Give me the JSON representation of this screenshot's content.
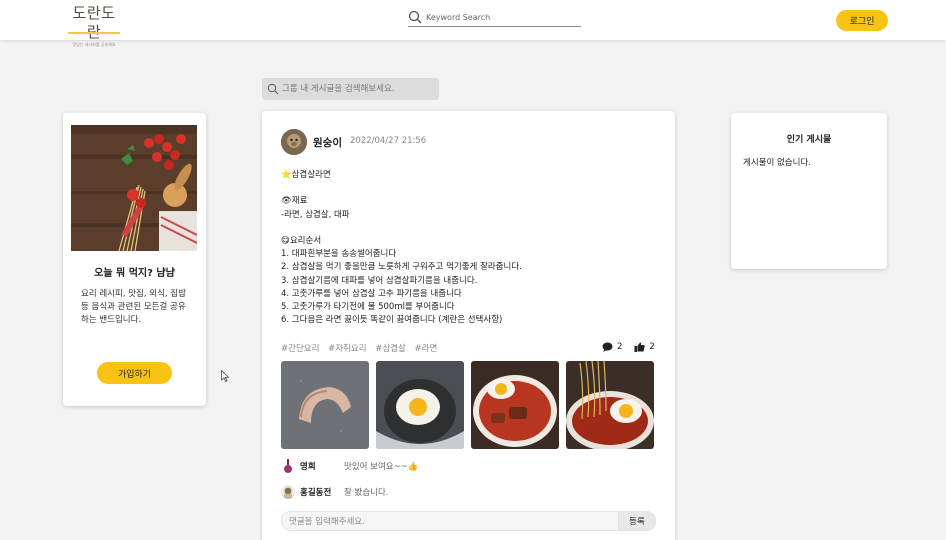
{
  "header": {
    "logo_title": "도란도란",
    "logo_sub": "맛있는 레시피를 공유해요",
    "search_placeholder": "Keyword Search",
    "login_label": "로그인"
  },
  "group_search": {
    "placeholder": "그룹 내 게시글을 검색해보세요."
  },
  "band": {
    "title": "오늘 뭐 먹지? 냠냠",
    "description": "요리 레시피, 맛집, 외식, 집밥 등 음식과 관련된 모든걸 공유하는 밴드입니다.",
    "join_label": "가입하기"
  },
  "post": {
    "author": "원숭이",
    "date": "2022/04/27 21:56",
    "lines": [
      "⭐삼겹살라면",
      "",
      "👁재료",
      "-라면, 삼겹살, 대파",
      "",
      "😋요리순서",
      "1. 대파흰부분을 송송썰어줍니다",
      "2. 삼겹살을 먹기 좋을만큼 노릇하게 구워주고 먹기좋게 잘라줍니다.",
      "3. 삼겹살기름에 대파를 넣어 삼겹살파기름을 내줍니다.",
      "4. 고춧가루를 넣어 삼겹살 고추 파기름을 내줍니다",
      "5. 고춧가루가 타기전에 물 500ml를 부어줍니다",
      "6. 그다음은 라면 끓이듯 똑같이 끓여줍니다 (계란은 선택사항)"
    ],
    "tags": [
      "#간단요리",
      "#자취요리",
      "#삼겹살",
      "#라면"
    ],
    "comment_count": "2",
    "like_count": "2",
    "comments": [
      {
        "name": "영희",
        "text": "맛있어 보여요~~👍"
      },
      {
        "name": "홍길동전",
        "text": "잘 봤습니다."
      }
    ],
    "comment_placeholder": "댓글을 입력해주세요.",
    "submit_label": "등록"
  },
  "popular": {
    "title": "인기 게시물",
    "empty": "게시물이 없습니다."
  },
  "colors": {
    "accent": "#f8c313",
    "background": "#f3f3f3",
    "card": "#ffffff"
  }
}
